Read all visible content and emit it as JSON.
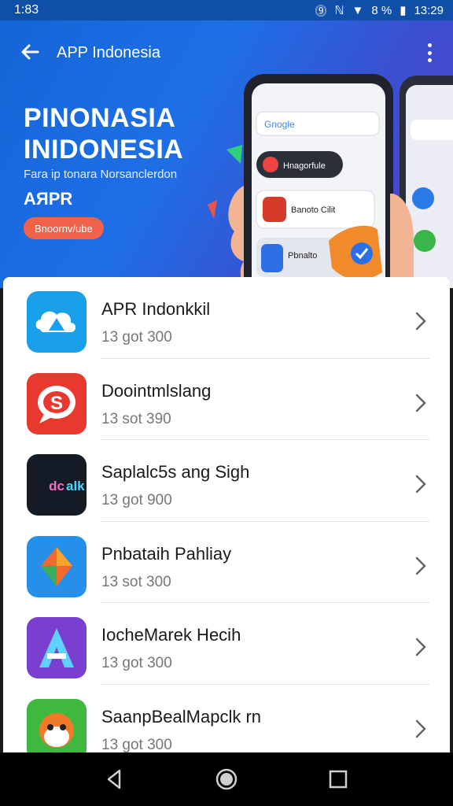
{
  "status_bar": {
    "left_time": "1:83",
    "battery": "8 %",
    "clock": "13:29"
  },
  "toolbar": {
    "title": "APP Indonesia"
  },
  "banner": {
    "headline_line1": "PINONASIA",
    "headline_line2": "INIDONESIA",
    "subtitle": "Fara ip tonara Norsanclerdon",
    "app_name": "AЯPR",
    "cta_label": "Bnoornv/ube",
    "phone_search_text": "Gnogle",
    "phone_card1_text": "Hnagorfule",
    "phone_card2_text": "Banoto Cilit",
    "phone_card3_text": "Pbnalto"
  },
  "apps": [
    {
      "title": "APR Indonkkil",
      "subtitle": "13 got 300",
      "icon": "cloud-app-icon",
      "color": "#1aa0e8"
    },
    {
      "title": "Doointmlslang",
      "subtitle": "13 sot 390",
      "icon": "s-speech-icon",
      "color": "#e8392e"
    },
    {
      "title": "Saplalc5s ang Sigh",
      "subtitle": "13 got 900",
      "icon": "neon-text-icon",
      "color": "#1c2a3a"
    },
    {
      "title": "Pnbataih Pahliay",
      "subtitle": "13 sot 300",
      "icon": "kite-icon",
      "color": "#2590ea"
    },
    {
      "title": "IocheMarek Hecih",
      "subtitle": "13 got 300",
      "icon": "letter-a-icon",
      "color": "#7b3fd0"
    },
    {
      "title": "SaanpBealMapclk rn",
      "subtitle": "13 got 300",
      "icon": "animal-face-icon",
      "color": "#3fb83f"
    }
  ],
  "nav": {
    "back_icon": "nav-back-icon",
    "home_icon": "nav-home-icon",
    "recents_icon": "nav-recents-icon"
  }
}
